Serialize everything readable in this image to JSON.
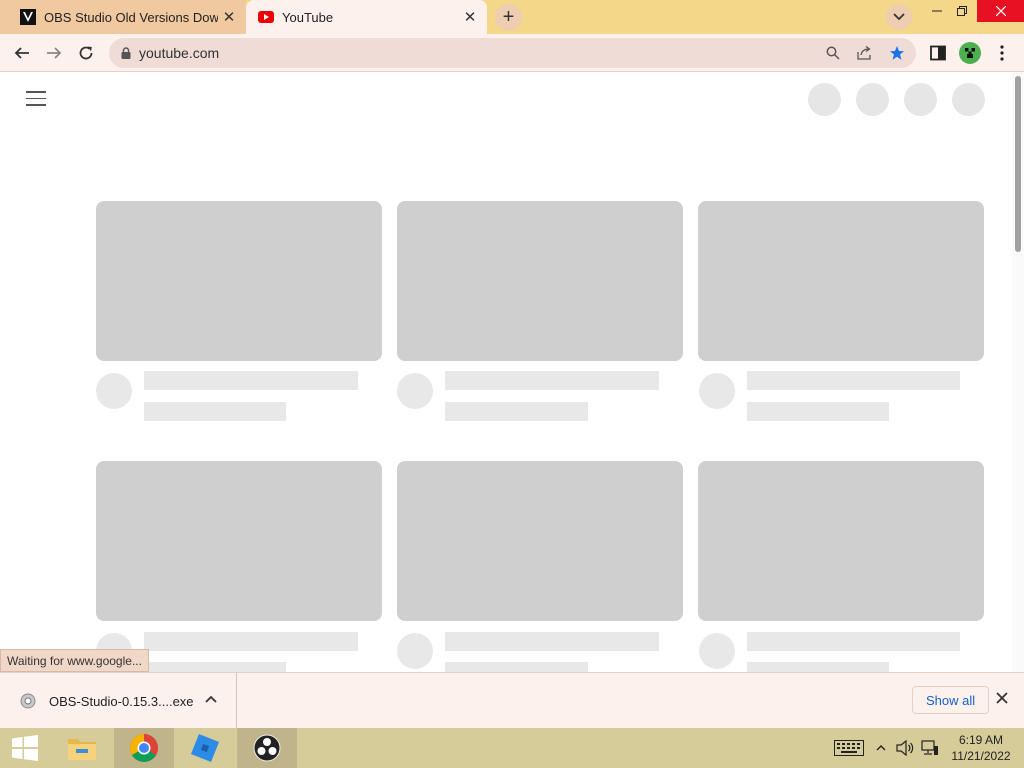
{
  "browser": {
    "tabs": [
      {
        "title": "OBS Studio Old Versions Downlo",
        "favicon": "v-logo-icon",
        "active": false
      },
      {
        "title": "YouTube",
        "favicon": "youtube-icon",
        "active": true
      }
    ],
    "new_tab_label": "+",
    "url": "youtube.com",
    "colors": {
      "tab_strip": "#f5d78a",
      "toolbar": "#fdf1ee",
      "accent_star": "#1a73e8"
    }
  },
  "status_bubble": "Waiting for www.google...",
  "download_bar": {
    "filename": "OBS-Studio-0.15.3....exe",
    "show_all": "Show all"
  },
  "taskbar": {
    "apps": [
      "start-icon",
      "file-explorer-icon",
      "chrome-icon",
      "roblox-studio-icon",
      "obs-icon"
    ],
    "active_app": "chrome-icon",
    "clock_time": "6:19 AM",
    "clock_date": "11/21/2022"
  }
}
